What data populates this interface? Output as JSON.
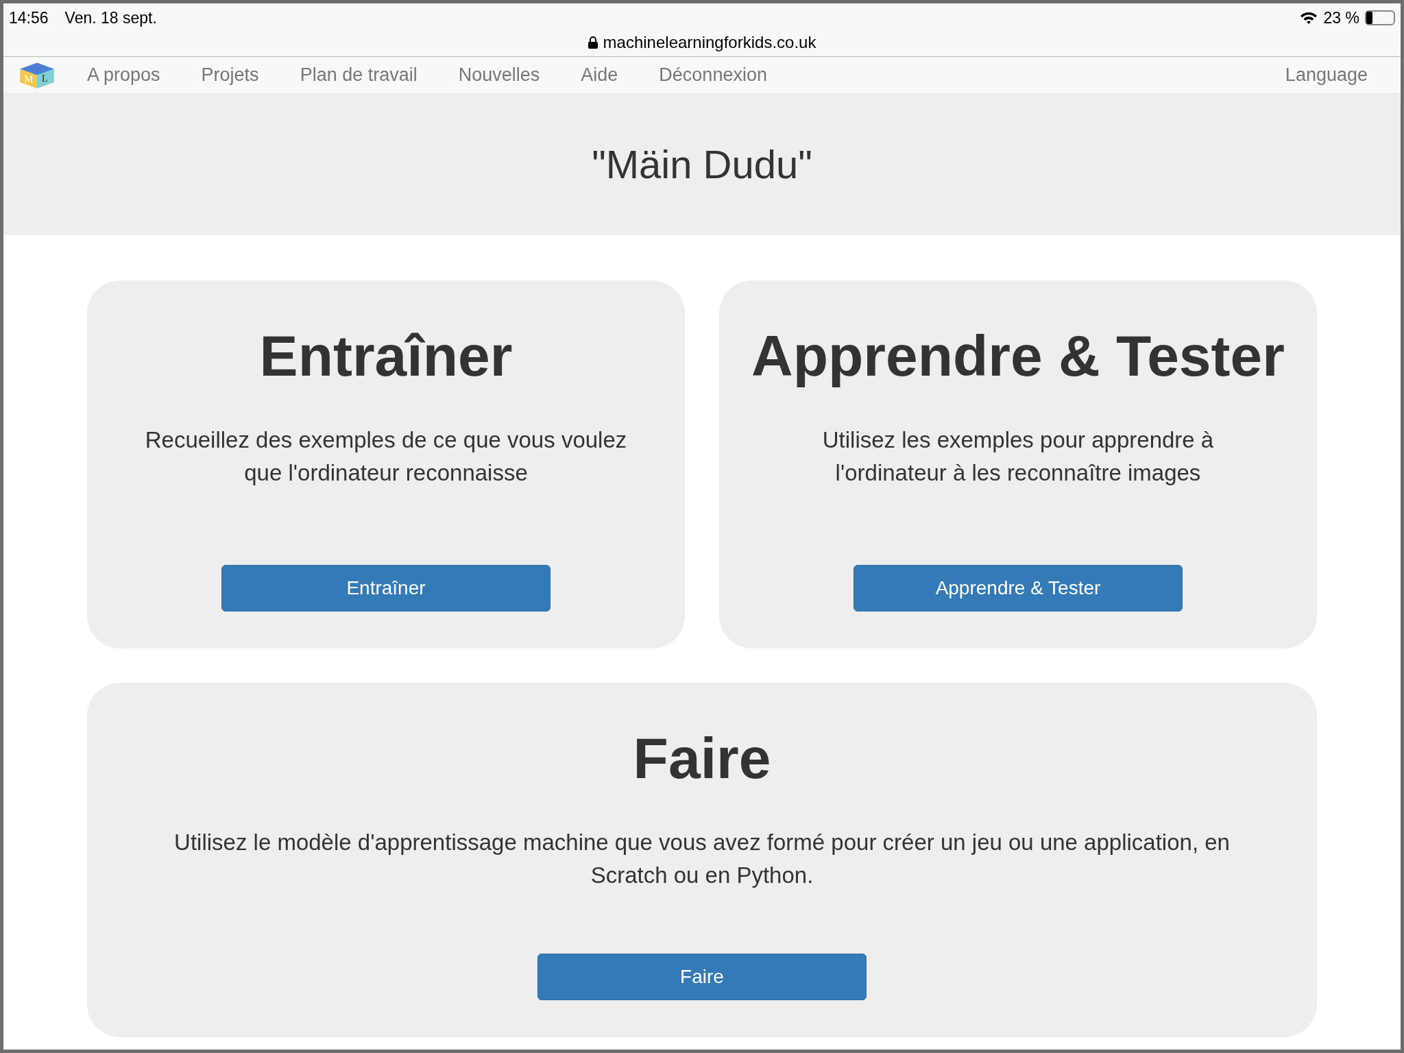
{
  "status_bar": {
    "time": "14:56",
    "date": "Ven. 18 sept.",
    "battery": "23 %",
    "level": 0.23
  },
  "address_bar": {
    "url": "machinelearningforkids.co.uk"
  },
  "navbar": {
    "logo_letters": [
      "M",
      "L"
    ],
    "items": [
      "A propos",
      "Projets",
      "Plan de travail",
      "Nouvelles",
      "Aide",
      "Déconnexion"
    ],
    "language": "Language"
  },
  "header": {
    "title": "\"Mäin Dudu\""
  },
  "cards": [
    {
      "title": "Entraîner",
      "text": "Recueillez des exemples de ce que vous voulez que l'ordinateur reconnaisse",
      "button": "Entraîner"
    },
    {
      "title": "Apprendre & Tester",
      "text": "Utilisez les exemples pour apprendre à l'ordinateur à les reconnaître images",
      "button": "Apprendre & Tester"
    },
    {
      "title": "Faire",
      "text": "Utilisez le modèle d'apprentissage machine que vous avez formé pour créer un jeu ou une application, en Scratch ou en Python.",
      "button": "Faire"
    }
  ]
}
